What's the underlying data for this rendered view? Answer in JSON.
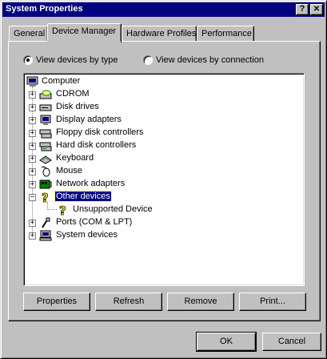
{
  "window": {
    "title": "System Properties",
    "help_glyph": "?",
    "close_glyph": "✕"
  },
  "tabs": [
    {
      "label": "General"
    },
    {
      "label": "Device Manager",
      "active": true
    },
    {
      "label": "Hardware Profiles"
    },
    {
      "label": "Performance"
    }
  ],
  "view_options": {
    "by_type": {
      "label": "View devices by type",
      "selected": true
    },
    "by_connection": {
      "label": "View devices by connection",
      "selected": false
    }
  },
  "tree": {
    "root": "Computer",
    "items": [
      {
        "label": "CDROM",
        "icon": "cdrom-icon"
      },
      {
        "label": "Disk drives",
        "icon": "disk-drive-icon"
      },
      {
        "label": "Display adapters",
        "icon": "display-icon"
      },
      {
        "label": "Floppy disk controllers",
        "icon": "floppy-controller-icon"
      },
      {
        "label": "Hard disk controllers",
        "icon": "hard-disk-controller-icon"
      },
      {
        "label": "Keyboard",
        "icon": "keyboard-icon"
      },
      {
        "label": "Mouse",
        "icon": "mouse-icon"
      },
      {
        "label": "Network adapters",
        "icon": "network-adapter-icon"
      },
      {
        "label": "Other devices",
        "icon": "question-icon",
        "expanded": true,
        "selected": true
      },
      {
        "label": "Unsupported Device",
        "icon": "question-icon",
        "child": true
      },
      {
        "label": "Ports (COM & LPT)",
        "icon": "port-icon"
      },
      {
        "label": "System devices",
        "icon": "system-devices-icon"
      }
    ]
  },
  "buttons": {
    "properties": "Properties",
    "refresh": "Refresh",
    "remove": "Remove",
    "print": "Print...",
    "ok": "OK",
    "cancel": "Cancel"
  }
}
